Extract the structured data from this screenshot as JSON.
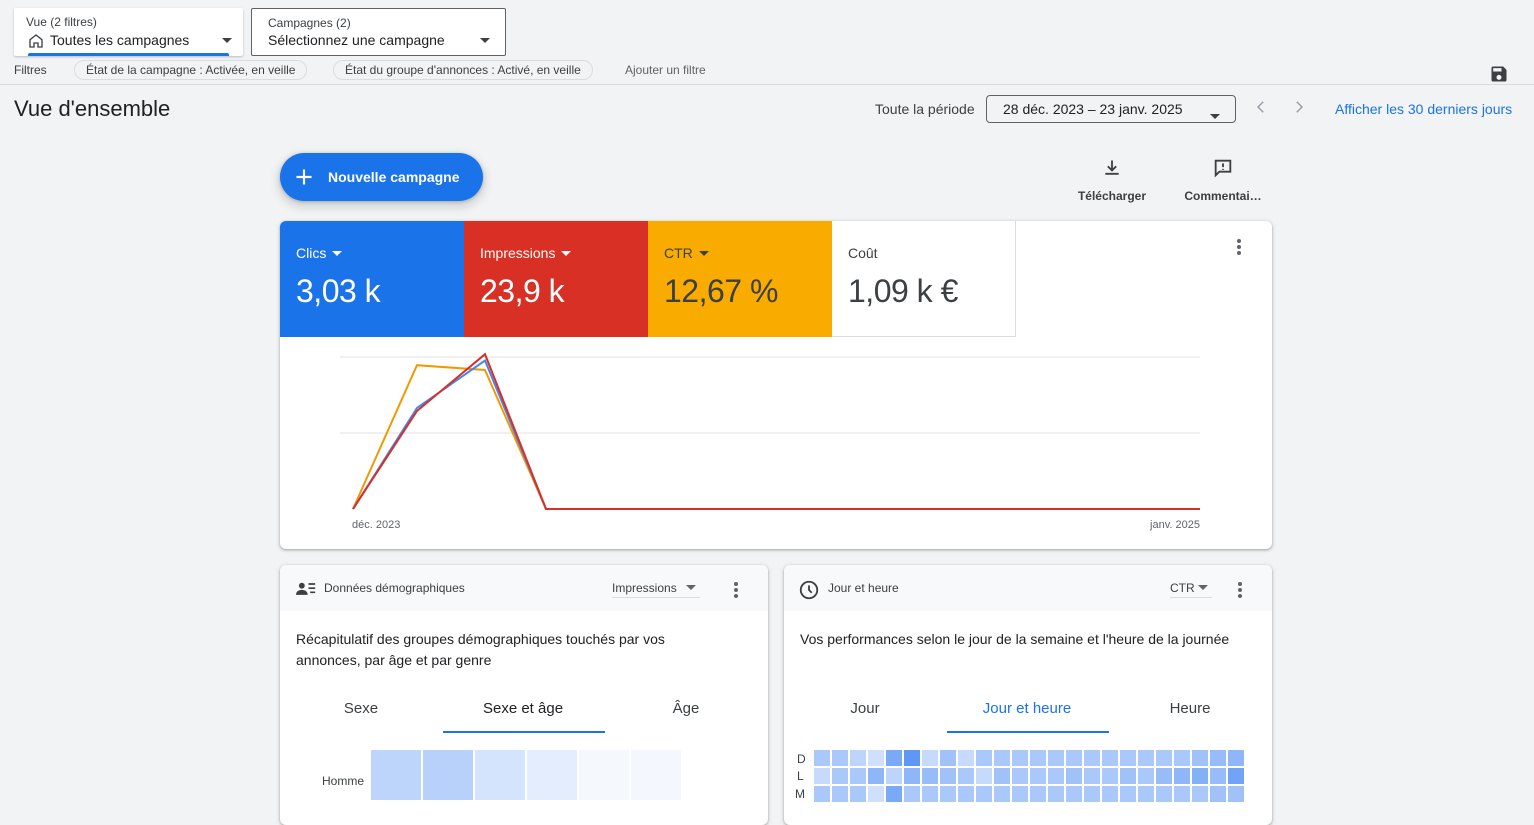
{
  "view_filter": {
    "label": "Vue (2 filtres)",
    "value": "Toutes les campagnes"
  },
  "campaign_filter": {
    "label": "Campagnes (2)",
    "value": "Sélectionnez une campagne"
  },
  "filters": {
    "label": "Filtres",
    "chips": [
      "État de la campagne : Activée, en veille",
      "État du groupe d'annonces : Activé, en veille"
    ],
    "add_label": "Ajouter un filtre"
  },
  "page_title": "Vue d'ensemble",
  "date": {
    "period_label": "Toute la période",
    "range": "28 déc. 2023 – 23 janv. 2025",
    "last30_link": "Afficher les 30 derniers jours"
  },
  "actions": {
    "new_campaign": "Nouvelle campagne",
    "download": "Télécharger",
    "comments": "Commentai…"
  },
  "metrics": [
    {
      "label": "Clics",
      "value": "3,03 k",
      "color": "#1a73e8",
      "dropdown": true
    },
    {
      "label": "Impressions",
      "value": "23,9 k",
      "color": "#d93025",
      "dropdown": true
    },
    {
      "label": "CTR",
      "value": "12,67 %",
      "color": "#f9ab00",
      "dropdown": true
    },
    {
      "label": "Coût",
      "value": "1,09 k €",
      "color": "#ffffff",
      "dropdown": false
    }
  ],
  "chart_data": {
    "type": "line",
    "x_labels": [
      "déc. 2023",
      "janv. 2025"
    ],
    "series": [
      {
        "color": "#f29900",
        "values": [
          0,
          0.91,
          0.88,
          0,
          0,
          0
        ]
      },
      {
        "color": "#4285f4",
        "values": [
          0,
          0.64,
          0.94,
          0,
          0,
          0
        ]
      },
      {
        "color": "#d93025",
        "values": [
          0,
          0.62,
          0.98,
          0,
          0,
          0
        ]
      }
    ],
    "grid": true
  },
  "demographics": {
    "title": "Données démographiques",
    "metric": "Impressions",
    "description": "Récapitulatif des groupes démographiques touchés par vos annonces, par âge et par genre",
    "tabs": [
      "Sexe",
      "Sexe et âge",
      "Âge"
    ],
    "active_tab": 1,
    "row_labels": [
      "Homme"
    ],
    "cells": [
      0.35,
      0.38,
      0.22,
      0.15,
      0.05,
      0.06
    ]
  },
  "dayhour": {
    "title": "Jour et heure",
    "metric": "CTR",
    "description": "Vos performances selon le jour de la semaine et l'heure de la journée",
    "tabs": [
      "Jour",
      "Jour et heure",
      "Heure"
    ],
    "active_tab": 1,
    "row_labels": [
      "D",
      "L",
      "M"
    ],
    "colors": {
      "accent": "#1a73e8",
      "heat_low": "#d2e3fc",
      "heat_high": "#4285f4"
    }
  }
}
